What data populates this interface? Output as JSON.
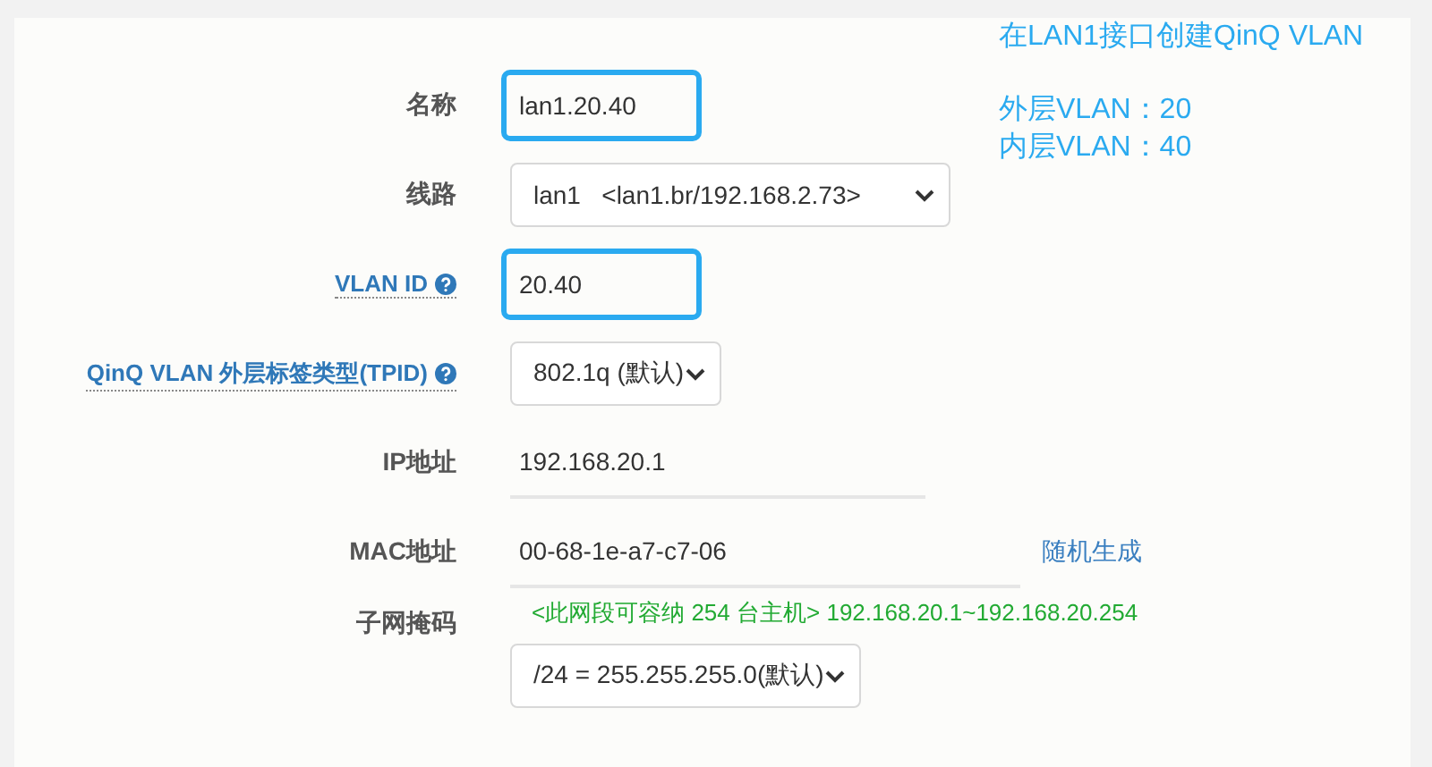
{
  "note": {
    "title": "在LAN1接口创建QinQ VLAN",
    "lines": [
      "外层VLAN：20",
      "内层VLAN：40"
    ]
  },
  "fields": [
    {
      "label": "名称",
      "help": false,
      "kind": "input",
      "value": "lan1.20.40",
      "highlighted": true
    },
    {
      "label": "线路",
      "help": false,
      "kind": "select",
      "value": "lan1   <lan1.br/192.168.2.73>",
      "highlighted": false
    },
    {
      "label": "VLAN ID",
      "help": true,
      "kind": "input",
      "value": "20.40",
      "highlighted": true
    },
    {
      "label": "QinQ VLAN 外层标签类型(TPID)",
      "help": true,
      "kind": "select",
      "value": "802.1q (默认)",
      "highlighted": false
    },
    {
      "label": "IP地址",
      "help": false,
      "kind": "input",
      "value": "192.168.20.1",
      "highlighted": false
    },
    {
      "label": "MAC地址",
      "help": false,
      "kind": "input",
      "value": "00-68-1e-a7-c7-06",
      "highlighted": false,
      "action": "随机生成"
    },
    {
      "label": "子网掩码",
      "help": false,
      "kind": "select",
      "value": "/24 = 255.255.255.0(默认)",
      "highlighted": false,
      "hint": "<此网段可容纳 254 台主机> 192.168.20.1~192.168.20.254"
    }
  ]
}
